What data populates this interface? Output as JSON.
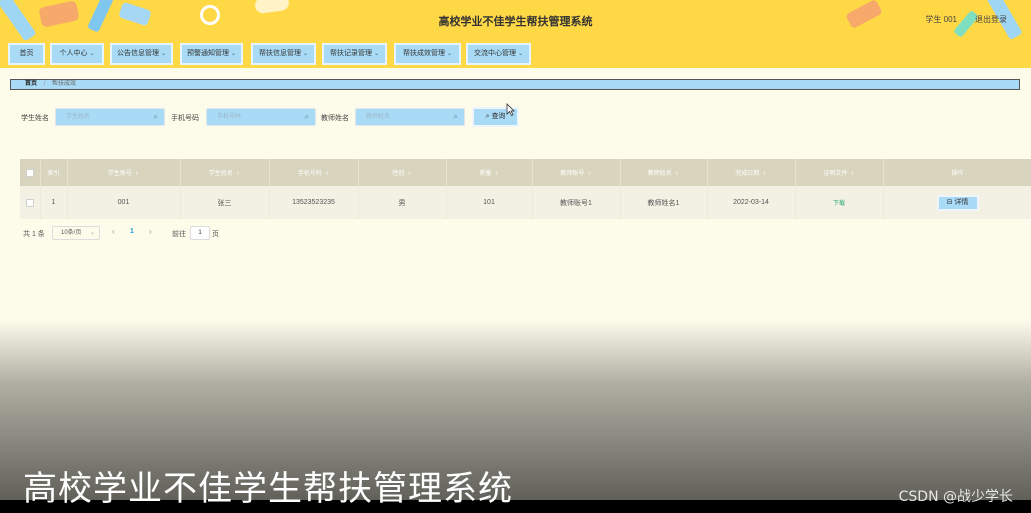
{
  "header": {
    "title": "高校学业不佳学生帮扶管理系统",
    "user": "学生 001",
    "logout": "退出登录"
  },
  "nav": [
    {
      "label": "首页",
      "dropdown": false
    },
    {
      "label": "个人中心",
      "dropdown": true
    },
    {
      "label": "公告信息管理",
      "dropdown": true
    },
    {
      "label": "预警通知管理",
      "dropdown": true
    },
    {
      "label": "帮扶信息管理",
      "dropdown": true
    },
    {
      "label": "帮扶记录管理",
      "dropdown": true
    },
    {
      "label": "帮扶成效管理",
      "dropdown": true
    },
    {
      "label": "交流中心管理",
      "dropdown": true
    }
  ],
  "breadcrumb": {
    "home": "首页",
    "current": "帮扶成效"
  },
  "search": {
    "student_name_label": "学生姓名",
    "student_name_placeholder": "学生姓名",
    "phone_label": "手机号码",
    "phone_placeholder": "手机号码",
    "teacher_name_label": "教师姓名",
    "teacher_name_placeholder": "教师姓名",
    "query_label": "查询"
  },
  "table": {
    "columns": [
      "索引",
      "学生账号",
      "学生姓名",
      "手机号码",
      "性别",
      "质量",
      "教师账号",
      "教师姓名",
      "完成日期",
      "证明文件",
      "操作"
    ],
    "rows": [
      {
        "index": "1",
        "student_account": "001",
        "student_name": "张三",
        "phone": "13523523235",
        "gender": "男",
        "score": "101",
        "teacher_account": "教师账号1",
        "teacher_name": "教师姓名1",
        "completion_date": "2022-03-14",
        "file": "下载",
        "action": "详情"
      }
    ]
  },
  "pagination": {
    "total": "共 1 条",
    "page_size": "10条/页",
    "current_page": "1",
    "goto_label": "前往",
    "goto_value": "1",
    "page_unit": "页"
  },
  "video": {
    "caption": "高校学业不佳学生帮扶管理系统",
    "watermark": "CSDN @战少学长"
  },
  "colors": {
    "header_bg": "#ffd845",
    "nav_button": "#a9dbf6",
    "page_bg": "#fdfbea",
    "table_header": "#d8d4bd",
    "download_link": "#2aa874"
  },
  "icons": [
    "search-icon",
    "chevron-down-icon",
    "sort-icon",
    "detail-icon",
    "cursor-icon"
  ]
}
